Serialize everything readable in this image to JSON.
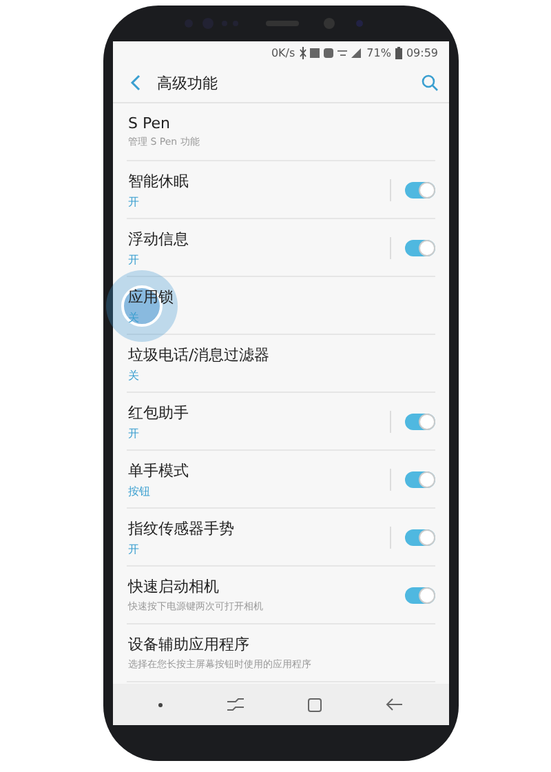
{
  "status_bar": {
    "speed": "0K/s",
    "battery": "71%",
    "time": "09:59"
  },
  "header": {
    "title": "高级功能"
  },
  "items": [
    {
      "kind": "link",
      "title": "S Pen",
      "description": "管理 S Pen 功能"
    },
    {
      "kind": "toggle",
      "title": "智能休眠",
      "summary": "开",
      "on": true
    },
    {
      "kind": "toggle",
      "title": "浮动信息",
      "summary": "开",
      "on": true
    },
    {
      "kind": "link",
      "title": "应用锁",
      "summary": "关",
      "touched": true
    },
    {
      "kind": "link",
      "title": "垃圾电话/消息过滤器",
      "summary": "关"
    },
    {
      "kind": "toggle",
      "title": "红包助手",
      "summary": "开",
      "on": true
    },
    {
      "kind": "toggle",
      "title": "单手模式",
      "summary": "按钮",
      "on": true
    },
    {
      "kind": "toggle",
      "title": "指纹传感器手势",
      "summary": "开",
      "on": true
    },
    {
      "kind": "toggle",
      "title": "快速启动相机",
      "description": "快速按下电源键两次可打开相机",
      "on": true
    },
    {
      "kind": "link",
      "title": "设备辅助应用程序",
      "description": "选择在您长按主屏幕按钮时使用的应用程序"
    }
  ]
}
